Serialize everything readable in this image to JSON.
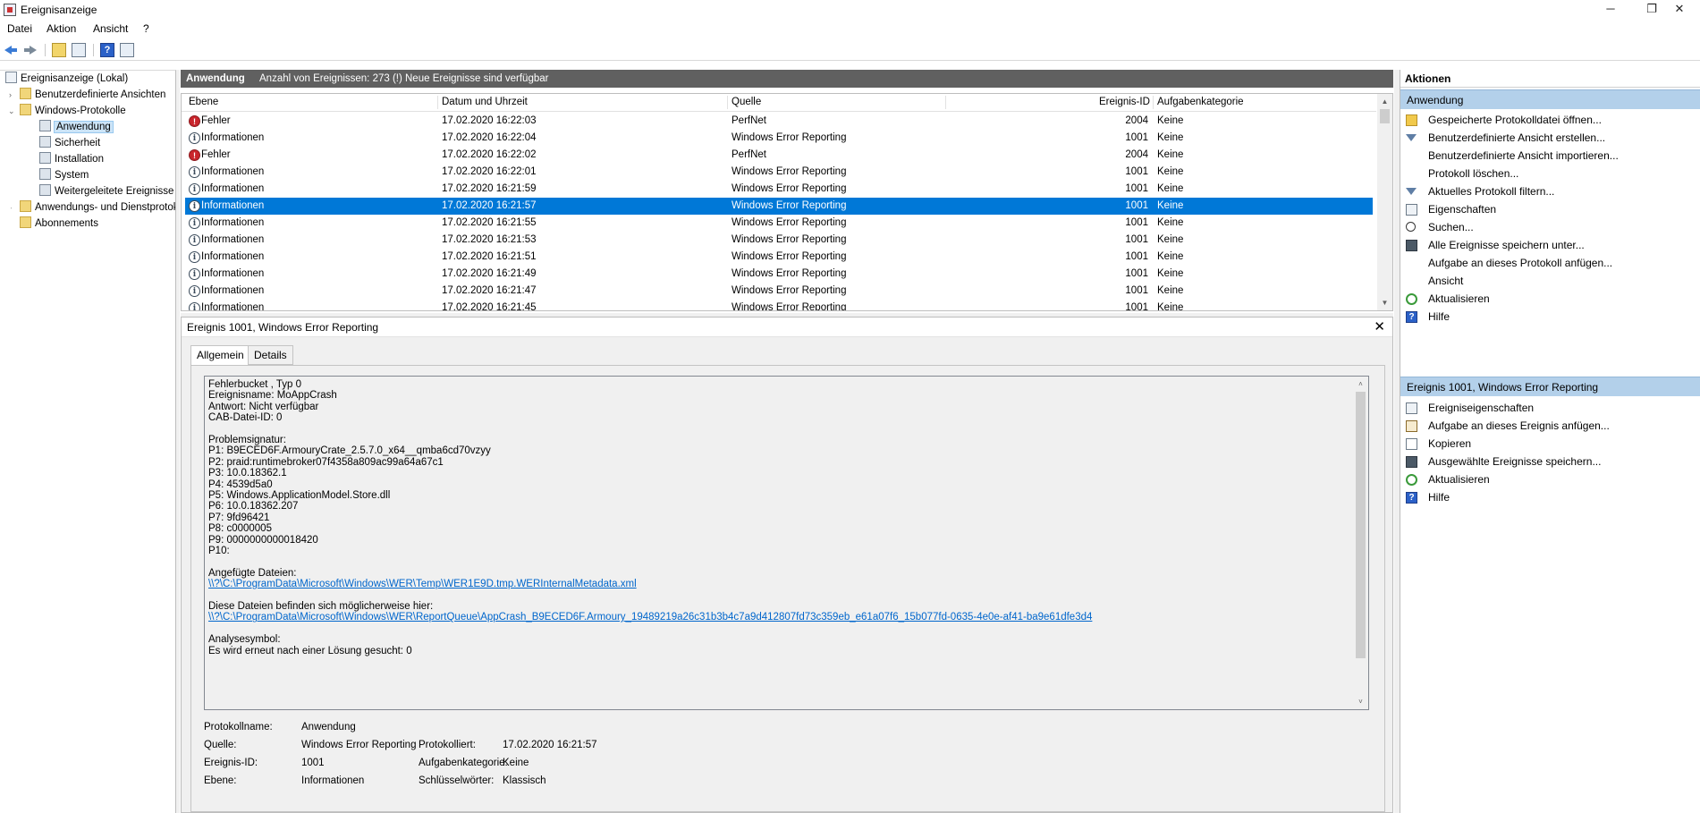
{
  "window": {
    "title": "Ereignisanzeige",
    "minimize": "─",
    "restore": "❐",
    "close": "✕"
  },
  "menu": [
    "Datei",
    "Aktion",
    "Ansicht",
    "?"
  ],
  "tree": {
    "root": "Ereignisanzeige (Lokal)",
    "custom_views": "Benutzerdefinierte Ansichten",
    "windows_logs": "Windows-Protokolle",
    "logs": [
      "Anwendung",
      "Sicherheit",
      "Installation",
      "System",
      "Weitergeleitete Ereignisse"
    ],
    "app_services": "Anwendungs- und Dienstprotokolle",
    "subscriptions": "Abonnements"
  },
  "list_header": {
    "log": "Anwendung",
    "count_text": "Anzahl von Ereignissen: 273 (!) Neue Ereignisse sind verfügbar"
  },
  "columns": {
    "level": "Ebene",
    "datetime": "Datum und Uhrzeit",
    "source": "Quelle",
    "event_id": "Ereignis-ID",
    "task_category": "Aufgabenkategorie"
  },
  "events": [
    {
      "level": "Fehler",
      "type": "error",
      "datetime": "17.02.2020 16:22:03",
      "source": "PerfNet",
      "id": "2004",
      "category": "Keine"
    },
    {
      "level": "Informationen",
      "type": "info",
      "datetime": "17.02.2020 16:22:04",
      "source": "Windows Error Reporting",
      "id": "1001",
      "category": "Keine"
    },
    {
      "level": "Fehler",
      "type": "error",
      "datetime": "17.02.2020 16:22:02",
      "source": "PerfNet",
      "id": "2004",
      "category": "Keine"
    },
    {
      "level": "Informationen",
      "type": "info",
      "datetime": "17.02.2020 16:22:01",
      "source": "Windows Error Reporting",
      "id": "1001",
      "category": "Keine"
    },
    {
      "level": "Informationen",
      "type": "info",
      "datetime": "17.02.2020 16:21:59",
      "source": "Windows Error Reporting",
      "id": "1001",
      "category": "Keine"
    },
    {
      "level": "Informationen",
      "type": "info",
      "datetime": "17.02.2020 16:21:57",
      "source": "Windows Error Reporting",
      "id": "1001",
      "category": "Keine",
      "selected": true
    },
    {
      "level": "Informationen",
      "type": "info",
      "datetime": "17.02.2020 16:21:55",
      "source": "Windows Error Reporting",
      "id": "1001",
      "category": "Keine"
    },
    {
      "level": "Informationen",
      "type": "info",
      "datetime": "17.02.2020 16:21:53",
      "source": "Windows Error Reporting",
      "id": "1001",
      "category": "Keine"
    },
    {
      "level": "Informationen",
      "type": "info",
      "datetime": "17.02.2020 16:21:51",
      "source": "Windows Error Reporting",
      "id": "1001",
      "category": "Keine"
    },
    {
      "level": "Informationen",
      "type": "info",
      "datetime": "17.02.2020 16:21:49",
      "source": "Windows Error Reporting",
      "id": "1001",
      "category": "Keine"
    },
    {
      "level": "Informationen",
      "type": "info",
      "datetime": "17.02.2020 16:21:47",
      "source": "Windows Error Reporting",
      "id": "1001",
      "category": "Keine"
    },
    {
      "level": "Informationen",
      "type": "info",
      "datetime": "17.02.2020 16:21:45",
      "source": "Windows Error Reporting",
      "id": "1001",
      "category": "Keine"
    }
  ],
  "details": {
    "title": "Ereignis 1001, Windows Error Reporting",
    "close": "✕",
    "tabs": [
      "Allgemein",
      "Details"
    ],
    "text_lines": [
      {
        "text": "Fehlerbucket , Typ 0"
      },
      {
        "text": "Ereignisname: MoAppCrash"
      },
      {
        "text": "Antwort: Nicht verfügbar"
      },
      {
        "text": "CAB-Datei-ID: 0"
      },
      {
        "text": ""
      },
      {
        "text": "Problemsignatur:"
      },
      {
        "text": "P1: B9ECED6F.ArmouryCrate_2.5.7.0_x64__qmba6cd70vzyy"
      },
      {
        "text": "P2: praid:runtimebroker07f4358a809ac99a64a67c1"
      },
      {
        "text": "P3: 10.0.18362.1"
      },
      {
        "text": "P4: 4539d5a0"
      },
      {
        "text": "P5: Windows.ApplicationModel.Store.dll"
      },
      {
        "text": "P6: 10.0.18362.207"
      },
      {
        "text": "P7: 9fd96421"
      },
      {
        "text": "P8: c0000005"
      },
      {
        "text": "P9: 0000000000018420"
      },
      {
        "text": "P10:"
      },
      {
        "text": ""
      },
      {
        "text": "Angefügte Dateien:"
      },
      {
        "text": "\\\\?\\C:\\ProgramData\\Microsoft\\Windows\\WER\\Temp\\WER1E9D.tmp.WERInternalMetadata.xml",
        "link": true
      },
      {
        "text": ""
      },
      {
        "text": "Diese Dateien befinden sich möglicherweise hier:"
      },
      {
        "text": "\\\\?\\C:\\ProgramData\\Microsoft\\Windows\\WER\\ReportQueue\\AppCrash_B9ECED6F.Armoury_19489219a26c31b3b4c7a9d412807fd73c359eb_e61a07f6_15b077fd-0635-4e0e-af41-ba9e61dfe3d4",
        "link": true
      },
      {
        "text": ""
      },
      {
        "text": "Analysesymbol:"
      },
      {
        "text": "Es wird erneut nach einer Lösung gesucht: 0"
      }
    ],
    "props": {
      "logname_label": "Protokollname:",
      "logname_value": "Anwendung",
      "source_label": "Quelle:",
      "source_value": "Windows Error Reporting",
      "logged_label": "Protokolliert:",
      "logged_value": "17.02.2020 16:21:57",
      "eventid_label": "Ereignis-ID:",
      "eventid_value": "1001",
      "taskcat_label": "Aufgabenkategorie:",
      "taskcat_value": "Keine",
      "level_label": "Ebene:",
      "level_value": "Informationen",
      "keywords_label": "Schlüsselwörter:",
      "keywords_value": "Klassisch"
    }
  },
  "actions": {
    "title": "Aktionen",
    "section1": "Anwendung",
    "items1": [
      {
        "label": "Gespeicherte Protokolldatei öffnen...",
        "icon": "folder-open-icon"
      },
      {
        "label": "Benutzerdefinierte Ansicht erstellen...",
        "icon": "filter-icon"
      },
      {
        "label": "Benutzerdefinierte Ansicht importieren...",
        "icon": ""
      },
      {
        "label": "Protokoll löschen...",
        "icon": ""
      },
      {
        "label": "Aktuelles Protokoll filtern...",
        "icon": "filter-icon"
      },
      {
        "label": "Eigenschaften",
        "icon": "properties-icon"
      },
      {
        "label": "Suchen...",
        "icon": "find-icon"
      },
      {
        "label": "Alle Ereignisse speichern unter...",
        "icon": "save-icon"
      },
      {
        "label": "Aufgabe an dieses Protokoll anfügen...",
        "icon": ""
      },
      {
        "label": "Ansicht",
        "icon": ""
      },
      {
        "label": "Aktualisieren",
        "icon": "refresh-icon"
      },
      {
        "label": "Hilfe",
        "icon": "help-icon"
      }
    ],
    "section2": "Ereignis 1001, Windows Error Reporting",
    "items2": [
      {
        "label": "Ereigniseigenschaften",
        "icon": "properties-icon"
      },
      {
        "label": "Aufgabe an dieses Ereignis anfügen...",
        "icon": "task-icon"
      },
      {
        "label": "Kopieren",
        "icon": "copy-icon"
      },
      {
        "label": "Ausgewählte Ereignisse speichern...",
        "icon": "save-icon"
      },
      {
        "label": "Aktualisieren",
        "icon": "refresh-icon"
      },
      {
        "label": "Hilfe",
        "icon": "help-icon"
      }
    ]
  }
}
